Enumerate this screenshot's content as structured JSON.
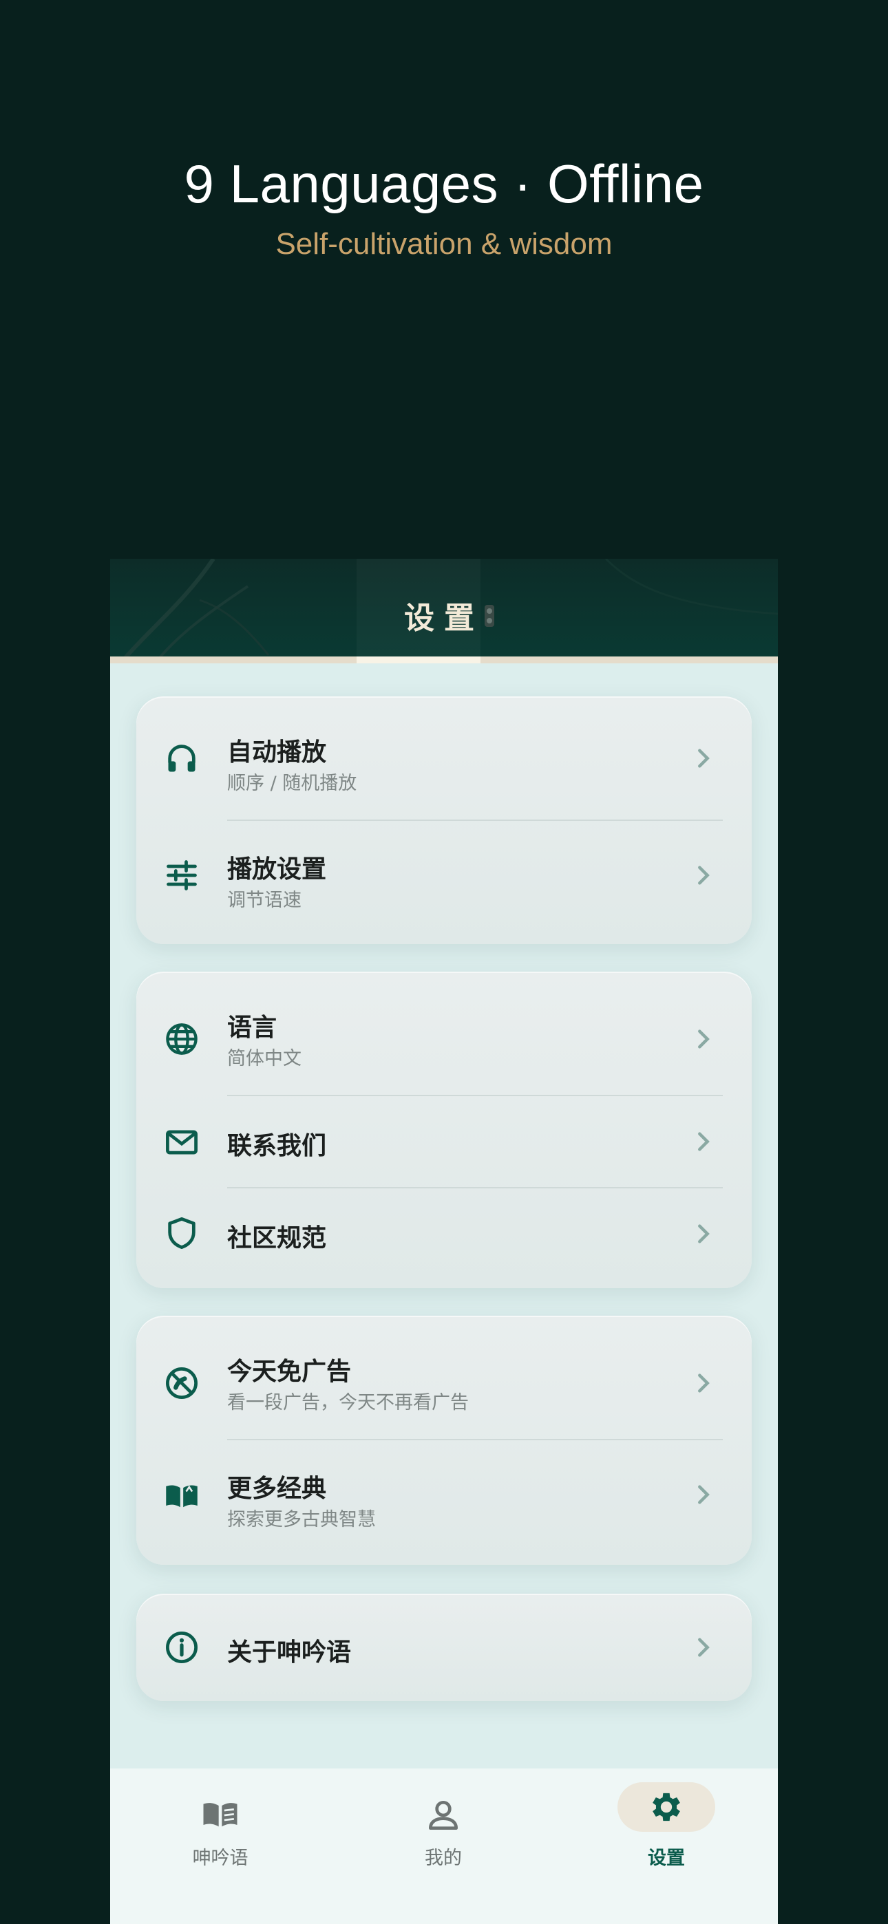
{
  "promo": {
    "title": "9 Languages · Offline",
    "subtitle": "Self-cultivation & wisdom"
  },
  "header": {
    "title": "设置"
  },
  "groups": [
    {
      "items": [
        {
          "icon": "headphones-icon",
          "title": "自动播放",
          "subtitle": "顺序 / 随机播放"
        },
        {
          "icon": "sliders-icon",
          "title": "播放设置",
          "subtitle": "调节语速"
        }
      ]
    },
    {
      "items": [
        {
          "icon": "globe-icon",
          "title": "语言",
          "subtitle": "简体中文"
        },
        {
          "icon": "mail-icon",
          "title": "联系我们",
          "subtitle": ""
        },
        {
          "icon": "shield-icon",
          "title": "社区规范",
          "subtitle": ""
        }
      ]
    },
    {
      "items": [
        {
          "icon": "no-ads-icon",
          "title": "今天免广告",
          "subtitle": "看一段广告，今天不再看广告"
        },
        {
          "icon": "open-book-icon",
          "title": "更多经典",
          "subtitle": "探索更多古典智慧"
        }
      ]
    },
    {
      "items": [
        {
          "icon": "info-icon",
          "title": "关于呻吟语",
          "subtitle": ""
        }
      ]
    }
  ],
  "tabbar": {
    "tabs": [
      {
        "icon": "book-icon",
        "label": "呻吟语",
        "active": false
      },
      {
        "icon": "person-icon",
        "label": "我的",
        "active": false
      },
      {
        "icon": "gear-icon",
        "label": "设置",
        "active": true
      }
    ]
  },
  "colors": {
    "background": "#08201d",
    "accent": "#0b5c4c",
    "gold": "#c9a36b",
    "panel": "#dceeed"
  }
}
